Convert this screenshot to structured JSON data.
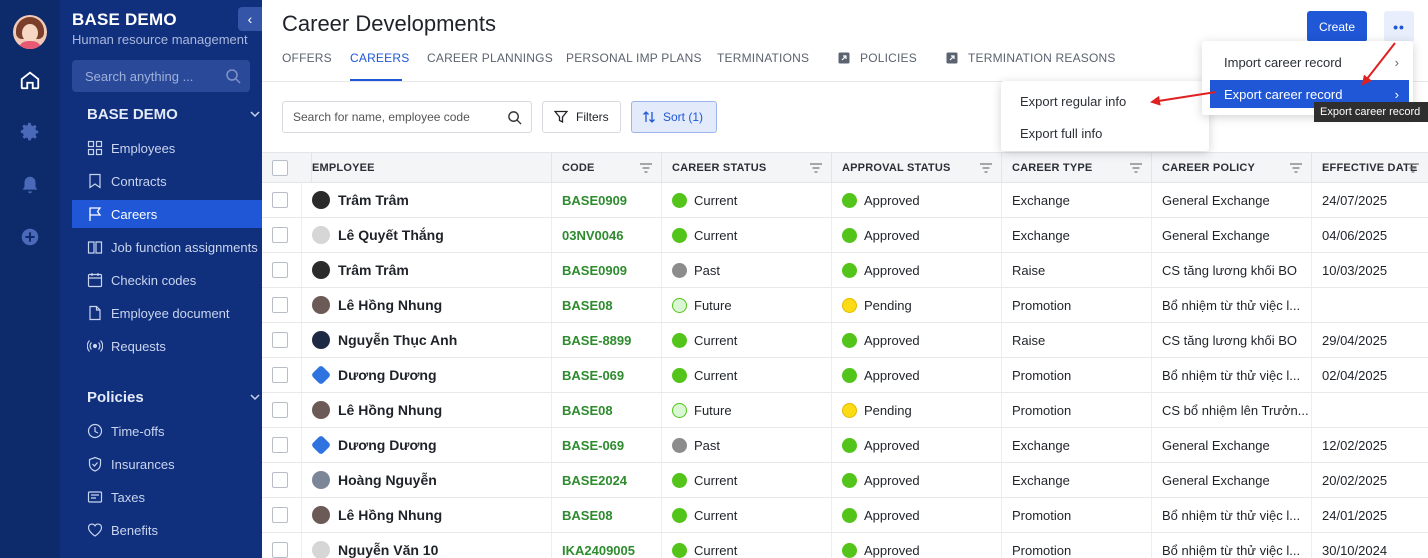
{
  "app": {
    "brand_title": "BASE DEMO",
    "brand_subtitle": "Human resource management",
    "search_placeholder": "Search anything ..."
  },
  "rail_icons": [
    "home-icon",
    "gear-icon",
    "bell-icon",
    "plus-circle-icon"
  ],
  "sidebar": {
    "section1": "BASE DEMO",
    "items1": [
      {
        "label": "Employees",
        "icon": "grid-icon"
      },
      {
        "label": "Contracts",
        "icon": "bookmark-icon"
      },
      {
        "label": "Careers",
        "icon": "flag-icon",
        "active": true
      },
      {
        "label": "Job function assignments",
        "icon": "book-icon"
      },
      {
        "label": "Checkin codes",
        "icon": "calendar-icon"
      },
      {
        "label": "Employee document",
        "icon": "document-icon"
      },
      {
        "label": "Requests",
        "icon": "broadcast-icon"
      }
    ],
    "section2": "Policies",
    "items2": [
      {
        "label": "Time-offs",
        "icon": "clock-icon"
      },
      {
        "label": "Insurances",
        "icon": "shield-icon"
      },
      {
        "label": "Taxes",
        "icon": "receipt-icon"
      },
      {
        "label": "Benefits",
        "icon": "heart-icon"
      }
    ]
  },
  "header": {
    "title": "Career Developments",
    "create_label": "Create",
    "more_label": "••"
  },
  "tabs": [
    {
      "label": "OFFERS"
    },
    {
      "label": "CAREERS",
      "active": true
    },
    {
      "label": "CAREER PLANNINGS"
    },
    {
      "label": "PERSONAL IMP PLANS"
    },
    {
      "label": "TERMINATIONS"
    },
    {
      "label": "POLICIES",
      "icon": "external-link-icon"
    },
    {
      "label": "TERMINATION REASONS",
      "icon": "external-link-icon"
    }
  ],
  "toolbar": {
    "search_placeholder": "Search for name, employee code",
    "filters_label": "Filters",
    "sort_label": "Sort (1)"
  },
  "table": {
    "columns": [
      "EMPLOYEE",
      "CODE",
      "CAREER STATUS",
      "APPROVAL STATUS",
      "CAREER TYPE",
      "CAREER POLICY",
      "EFFECTIVE DATE"
    ],
    "rows": [
      {
        "name": "Trâm Trâm",
        "code": "BASE0909",
        "career_status": "Current",
        "career_dot": "green",
        "approval": "Approved",
        "approval_dot": "green",
        "type": "Exchange",
        "policy": "General Exchange",
        "date": "24/07/2025",
        "avatar": "dark"
      },
      {
        "name": "Lê Quyết Thắng",
        "code": "03NV0046",
        "career_status": "Current",
        "career_dot": "green",
        "approval": "Approved",
        "approval_dot": "green",
        "type": "Exchange",
        "policy": "General Exchange",
        "date": "04/06/2025",
        "avatar": "grey"
      },
      {
        "name": "Trâm Trâm",
        "code": "BASE0909",
        "career_status": "Past",
        "career_dot": "grey",
        "approval": "Approved",
        "approval_dot": "green",
        "type": "Raise",
        "policy": "CS tăng lương khối BO",
        "date": "10/03/2025",
        "avatar": "dark"
      },
      {
        "name": "Lê Hồng Nhung",
        "code": "BASE08",
        "career_status": "Future",
        "career_dot": "light",
        "approval": "Pending",
        "approval_dot": "yellow",
        "type": "Promotion",
        "policy": "Bổ nhiệm từ thử việc l...",
        "date": "",
        "avatar": "photo"
      },
      {
        "name": "Nguyễn Thục Anh",
        "code": "BASE-8899",
        "career_status": "Current",
        "career_dot": "green",
        "approval": "Approved",
        "approval_dot": "green",
        "type": "Raise",
        "policy": "CS tăng lương khối BO",
        "date": "29/04/2025",
        "avatar": "navy"
      },
      {
        "name": "Dương Dương",
        "code": "BASE-069",
        "career_status": "Current",
        "career_dot": "green",
        "approval": "Approved",
        "approval_dot": "green",
        "type": "Promotion",
        "policy": "Bổ nhiệm từ thử việc l...",
        "date": "02/04/2025",
        "avatar": "logo"
      },
      {
        "name": "Lê Hồng Nhung",
        "code": "BASE08",
        "career_status": "Future",
        "career_dot": "light",
        "approval": "Pending",
        "approval_dot": "yellow",
        "type": "Promotion",
        "policy": "CS bổ nhiệm lên Trưởn...",
        "date": "",
        "avatar": "photo"
      },
      {
        "name": "Dương Dương",
        "code": "BASE-069",
        "career_status": "Past",
        "career_dot": "grey",
        "approval": "Approved",
        "approval_dot": "green",
        "type": "Exchange",
        "policy": "General Exchange",
        "date": "12/02/2025",
        "avatar": "logo"
      },
      {
        "name": "Hoàng Nguyễn",
        "code": "BASE2024",
        "career_status": "Current",
        "career_dot": "green",
        "approval": "Approved",
        "approval_dot": "green",
        "type": "Exchange",
        "policy": "General Exchange",
        "date": "20/02/2025",
        "avatar": "photo2"
      },
      {
        "name": "Lê Hồng Nhung",
        "code": "BASE08",
        "career_status": "Current",
        "career_dot": "green",
        "approval": "Approved",
        "approval_dot": "green",
        "type": "Promotion",
        "policy": "Bổ nhiệm từ thử việc l...",
        "date": "24/01/2025",
        "avatar": "photo"
      },
      {
        "name": "Nguyễn Văn 10",
        "code": "IKA2409005",
        "career_status": "Current",
        "career_dot": "green",
        "approval": "Approved",
        "approval_dot": "green",
        "type": "Promotion",
        "policy": "Bổ nhiệm từ thử việc l...",
        "date": "30/10/2024",
        "avatar": "grey"
      }
    ]
  },
  "menu": {
    "import_label": "Import career record",
    "export_label": "Export career record",
    "export_regular": "Export regular info",
    "export_full": "Export full info",
    "tooltip": "Export career record"
  },
  "colors": {
    "accent": "#1f57d6",
    "sidebar": "#10307d",
    "rail": "#0d2a6b",
    "code_green": "#2e8b2e",
    "annotation_red": "#e02020"
  }
}
